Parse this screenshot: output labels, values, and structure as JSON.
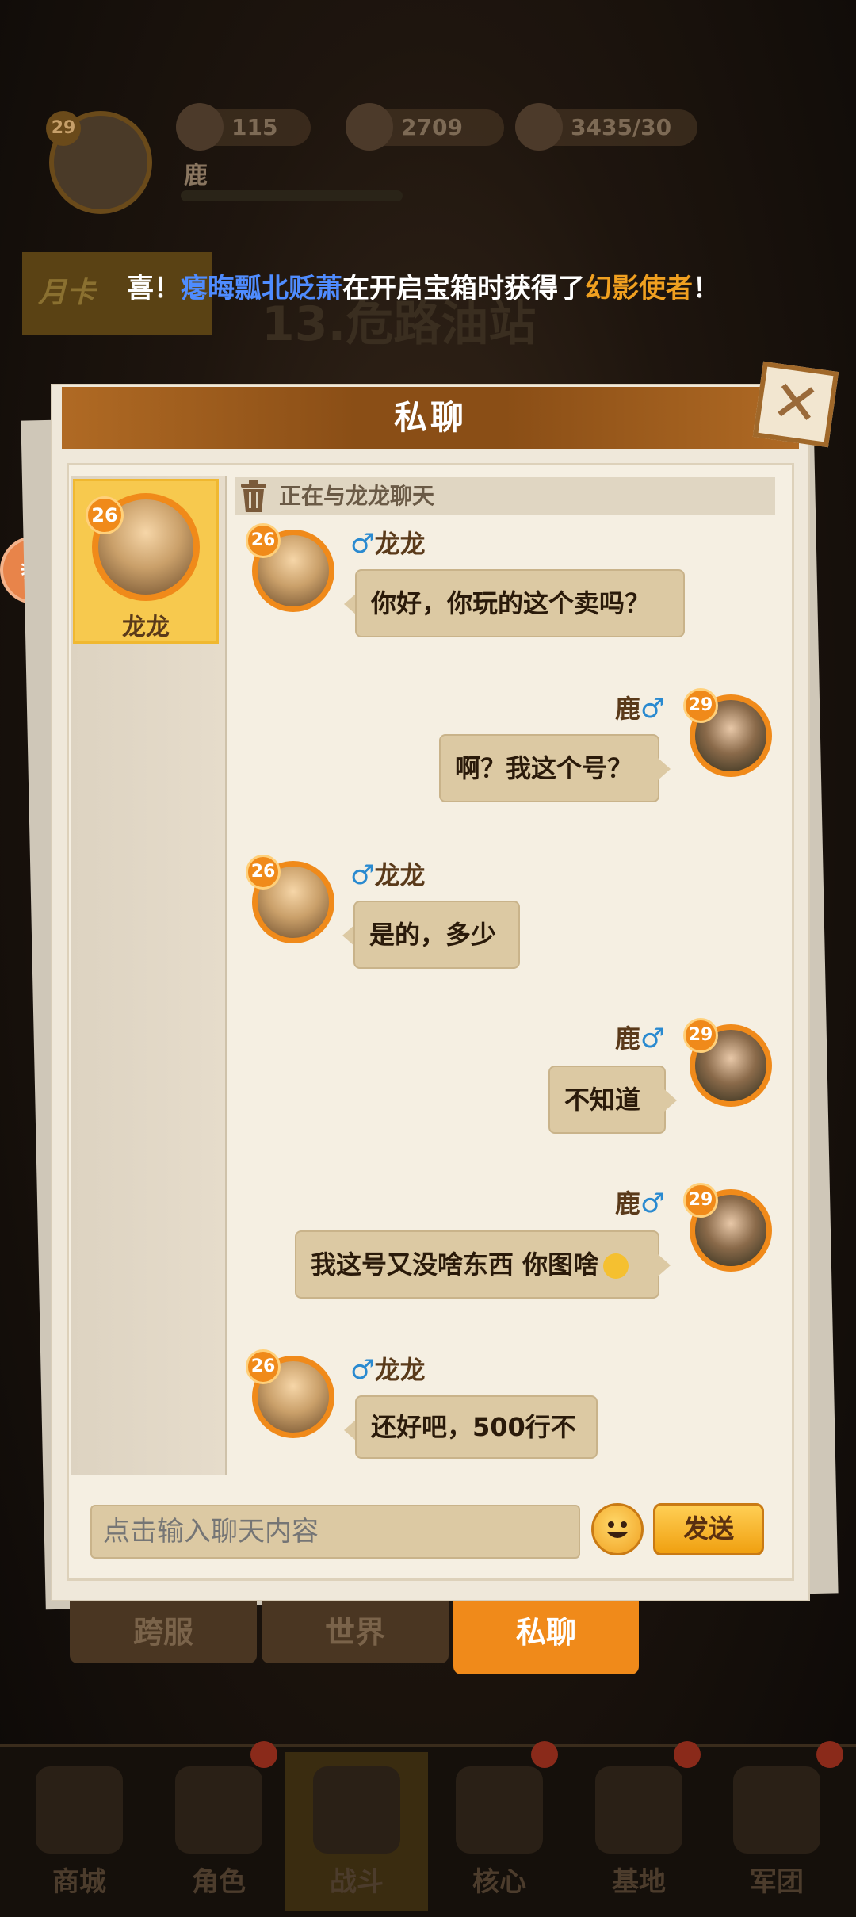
{
  "header": {
    "level": "29",
    "player_name": "鹿",
    "gems": "115",
    "coins": "2709",
    "stamina": "3435/30"
  },
  "bg": {
    "month_card": "月卡",
    "stage": "13.危路油站",
    "marquee_prefix": "喜！",
    "marquee_player": "瘪晦瓢北贬萧",
    "marquee_mid": "在开启宝箱时获得了",
    "marquee_item": "幻影使者",
    "marquee_suffix": "！"
  },
  "dialog": {
    "title": "私聊",
    "close_label": "✕",
    "chat_with": "正在与龙龙聊天",
    "input_placeholder": "点击输入聊天内容",
    "send_label": "发送"
  },
  "contacts": [
    {
      "name": "龙龙",
      "level": "26"
    }
  ],
  "messages": [
    {
      "side": "left",
      "name": "龙龙",
      "gender": "♂",
      "level": "26",
      "text": "你好，你玩的这个卖吗？"
    },
    {
      "side": "right",
      "name": "鹿",
      "gender": "♂",
      "level": "29",
      "text": "啊？我这个号？"
    },
    {
      "side": "left",
      "name": "龙龙",
      "gender": "♂",
      "level": "26",
      "text": "是的，多少"
    },
    {
      "side": "right",
      "name": "鹿",
      "gender": "♂",
      "level": "29",
      "text": "不知道"
    },
    {
      "side": "right",
      "name": "鹿",
      "gender": "♂",
      "level": "29",
      "text": "我这号又没啥东西 你图啥",
      "emoji": "smirk-emoji"
    },
    {
      "side": "left",
      "name": "龙龙",
      "gender": "♂",
      "level": "26",
      "text": "还好吧，500行不"
    }
  ],
  "channel_tabs": [
    {
      "label": "跨服",
      "active": false
    },
    {
      "label": "世界",
      "active": false
    },
    {
      "label": "私聊",
      "active": true
    }
  ],
  "nav": [
    {
      "label": "商城"
    },
    {
      "label": "角色"
    },
    {
      "label": "战斗",
      "active": true
    },
    {
      "label": "核心"
    },
    {
      "label": "基地"
    },
    {
      "label": "军团"
    }
  ],
  "colors": {
    "accent": "#f08a1a",
    "bubble": "#dcc9a3",
    "male": "#2a8ad0",
    "marquee_player": "#4f8cff",
    "marquee_item": "#f0a020"
  }
}
